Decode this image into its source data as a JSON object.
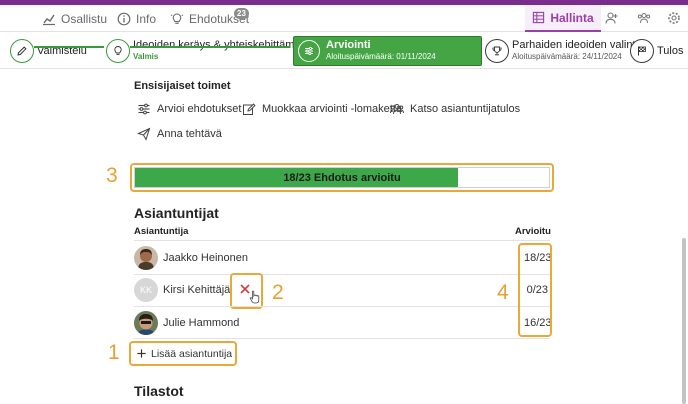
{
  "nav": {
    "participants": "Osallistu",
    "info": "Info",
    "proposals": "Ehdotukset",
    "proposals_badge": "23",
    "manage": "Hallinta"
  },
  "phases": {
    "prep": {
      "name": "Valmistelu"
    },
    "collect": {
      "name": "Ideoiden keräys & yhteiskehittäminen",
      "status": "Valmis"
    },
    "evaluate": {
      "name": "Arviointi",
      "sub": "Aloituspäivämäärä: 01/11/2024"
    },
    "select": {
      "name": "Parhaiden ideoiden valinta",
      "sub": "Aloituspäivämäärä: 24/11/2024"
    },
    "result": {
      "name": "Tulos"
    }
  },
  "first_actions": {
    "title": "Ensisijaiset toimet",
    "rate": "Arvioi ehdotukset",
    "edit_form": "Muokkaa arviointi -lomaketta",
    "view_results": "Katso asiantuntijatulos",
    "assign": "Anna tehtävä"
  },
  "progress": {
    "label": "18/23 Ehdotus arvioitu",
    "fraction": 0.78
  },
  "experts": {
    "title": "Asiantuntijat",
    "col_name": "Asiantuntija",
    "col_rated": "Arvioitu",
    "rows": [
      {
        "name": "Jaakko Heinonen",
        "rated": "18/23"
      },
      {
        "name": "Kirsi Kehittäjä",
        "initials": "KK",
        "rated": "0/23"
      },
      {
        "name": "Julie Hammond",
        "rated": "16/23"
      }
    ],
    "add_label": "Lisää asiantuntija"
  },
  "stats": {
    "title": "Tilastot"
  },
  "annotations": [
    "1",
    "2",
    "3",
    "4"
  ],
  "colors": {
    "brand": "#7b2d8e",
    "accent_purple": "#9a3fa6",
    "phase_green": "#45a545",
    "progress_green": "#3da84a",
    "annotation_orange": "#e8a93a",
    "delete_red": "#d93a3a"
  }
}
